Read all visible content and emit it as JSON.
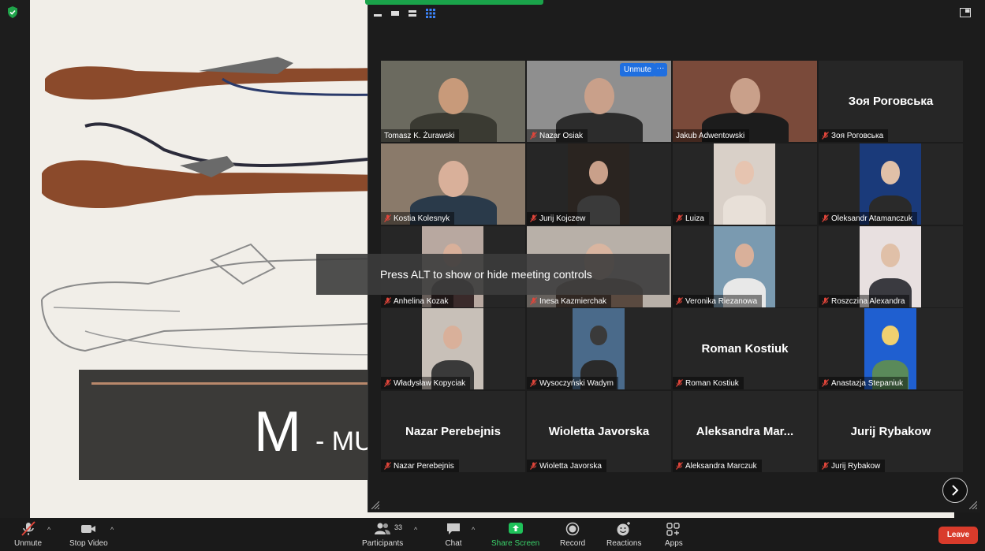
{
  "slide": {
    "letter": "M",
    "rest": "- MU"
  },
  "toast": "Press ALT to show or hide meeting controls",
  "tile_controls": {
    "unmute": "Unmute",
    "more": "···"
  },
  "participants": [
    {
      "name": "Tomasz K. Żurawski",
      "muted": false,
      "video": true,
      "active": true
    },
    {
      "name": "Nazar Osiak",
      "muted": true,
      "video": true
    },
    {
      "name": "Jakub Adwentowski",
      "muted": false,
      "video": true
    },
    {
      "name": "Зоя Роговська",
      "muted": true,
      "video": false,
      "display": "Зоя Роговська"
    },
    {
      "name": "Kostia Kolesnyk",
      "muted": true,
      "video": true
    },
    {
      "name": "Jurij Kojczew",
      "muted": true,
      "video": true
    },
    {
      "name": "Luiza",
      "muted": true,
      "video": true
    },
    {
      "name": "Oleksandr Atamanczuk",
      "muted": true,
      "video": true
    },
    {
      "name": "Anhelina Kozak",
      "muted": true,
      "video": true
    },
    {
      "name": "Inesa Kazmierchak",
      "muted": true,
      "video": true
    },
    {
      "name": "Veronika Riezanowa",
      "muted": true,
      "video": true
    },
    {
      "name": "Roszczina Alexandra",
      "muted": true,
      "video": true
    },
    {
      "name": "Władysław Kopyciak",
      "muted": true,
      "video": true
    },
    {
      "name": "Wysoczyński Wadym",
      "muted": true,
      "video": true
    },
    {
      "name": "Roman Kostiuk",
      "muted": true,
      "video": false,
      "display": "Roman Kostiuk"
    },
    {
      "name": "Anastazja Stepaniuk",
      "muted": true,
      "video": true
    },
    {
      "name": "Nazar Perebejnis",
      "muted": true,
      "video": false,
      "display": "Nazar Perebejnis"
    },
    {
      "name": "Wioletta Javorska",
      "muted": true,
      "video": false,
      "display": "Wioletta Javorska"
    },
    {
      "name": "Aleksandra Marczuk",
      "muted": true,
      "video": false,
      "display": "Aleksandra  Mar..."
    },
    {
      "name": "Jurij Rybakow",
      "muted": true,
      "video": false,
      "display": "Jurij Rybakow"
    }
  ],
  "toolbar": {
    "unmute": "Unmute",
    "stop_video": "Stop Video",
    "participants": "Participants",
    "participants_count": "33",
    "chat": "Chat",
    "share_screen": "Share Screen",
    "record": "Record",
    "reactions": "Reactions",
    "apps": "Apps",
    "leave": "Leave"
  },
  "colors": {
    "accent_green": "#1aa34a",
    "active_speaker": "#c8d45a",
    "unmute_blue": "#1f6fe0",
    "leave_red": "#d93b2b"
  }
}
